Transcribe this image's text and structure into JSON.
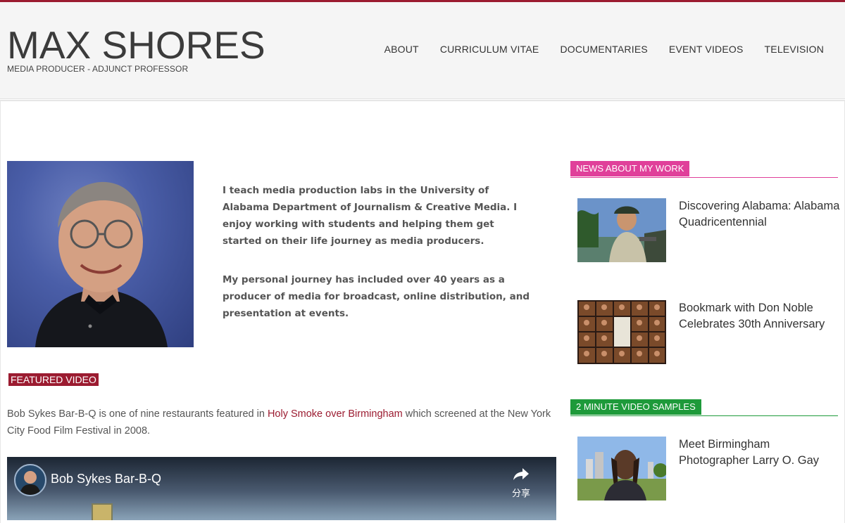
{
  "header": {
    "title": "MAX SHORES",
    "tagline": "MEDIA PRODUCER - ADJUNCT PROFESSOR",
    "nav": [
      "ABOUT",
      "CURRICULUM VITAE",
      "DOCUMENTARIES",
      "EVENT VIDEOS",
      "TELEVISION"
    ]
  },
  "intro": {
    "p1": "I teach media production labs in the University of Alabama Department of Journalism & Creative Media. I enjoy working with students and helping them get started on their life journey as media producers.",
    "p2": "My personal journey has included over 40 years as a producer of media for broadcast, online distribution, and presentation at events."
  },
  "featured": {
    "label": "FEATURED VIDEO",
    "text_before": "Bob Sykes Bar-B-Q is one of nine restaurants featured in ",
    "link": "Holy Smoke over Birmingham",
    "text_after": " which screened at the New York City Food Film Festival in 2008.",
    "video_title": "Bob Sykes Bar-B-Q",
    "share_label": "分享"
  },
  "sidebar": {
    "news": {
      "label": "NEWS ABOUT MY WORK",
      "color": "#e0409a",
      "items": [
        {
          "title": "Discovering Alabama: Alabama Quadricentennial"
        },
        {
          "title": "Bookmark with Don Noble Celebrates 30th Anniversary"
        }
      ]
    },
    "samples": {
      "label": "2 MINUTE VIDEO SAMPLES",
      "color": "#1e9a3a",
      "items": [
        {
          "title": "Meet Birmingham Photographer Larry O. Gay"
        }
      ]
    }
  },
  "colors": {
    "accent": "#9b1b30",
    "header_bg": "#f5f5f5"
  }
}
